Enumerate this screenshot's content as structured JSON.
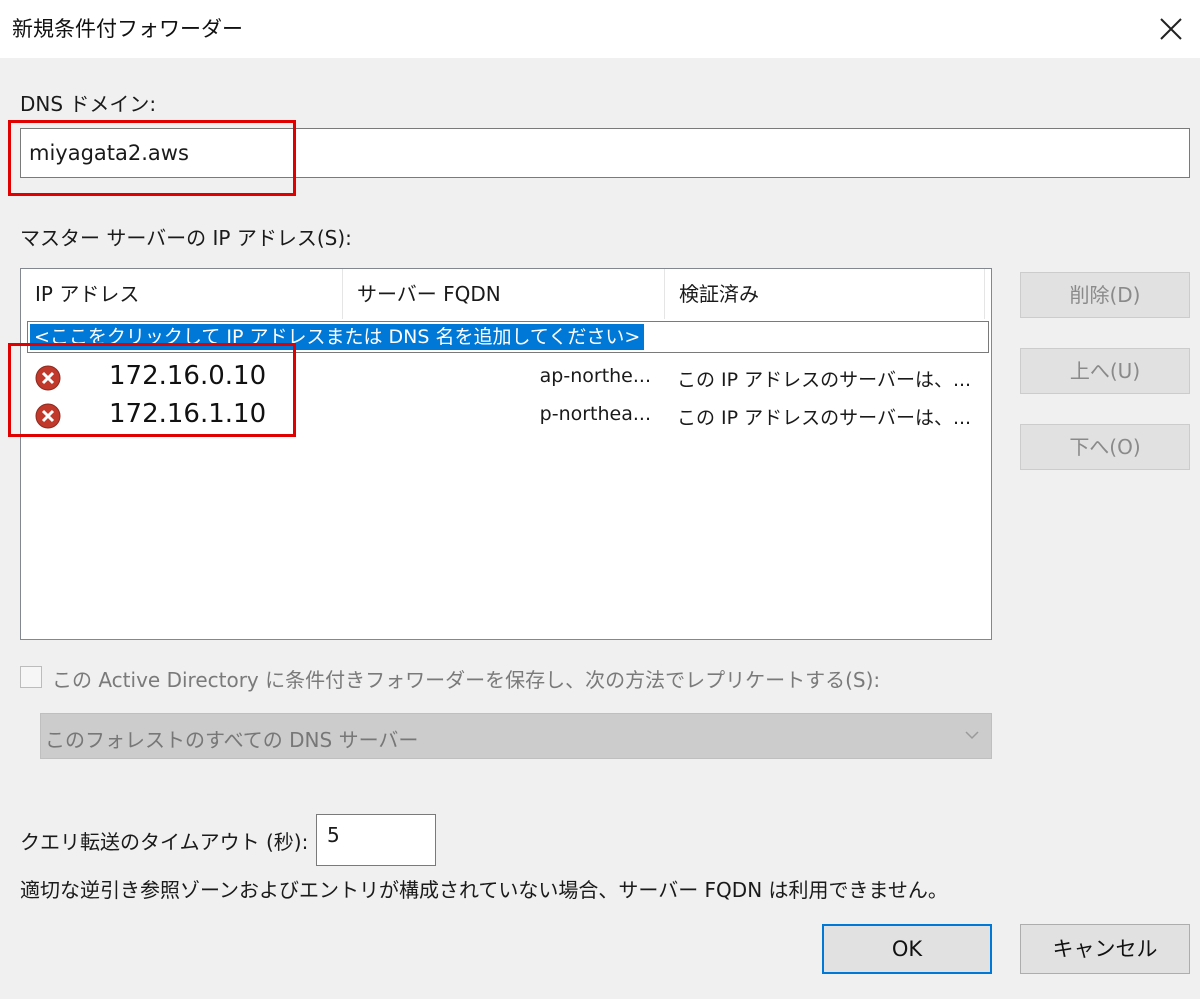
{
  "window": {
    "title": "新規条件付フォワーダー"
  },
  "dns_domain": {
    "label": "DNS ドメイン:",
    "value": "miyagata2.aws"
  },
  "master_servers": {
    "label": "マスター サーバーの IP アドレス(S):",
    "columns": [
      "IP アドレス",
      "サーバー FQDN",
      "検証済み"
    ],
    "add_prompt": "<ここをクリックして IP アドレスまたは DNS 名を追加してください>",
    "rows": [
      {
        "ip": "172.16.0.10",
        "fqdn": "ap-northe...",
        "verified": "この IP アドレスのサーバーは、...",
        "status_icon": "error-icon"
      },
      {
        "ip": "172.16.1.10",
        "fqdn": "p-northea...",
        "verified": "この IP アドレスのサーバーは、...",
        "status_icon": "error-icon"
      }
    ]
  },
  "side_buttons": {
    "delete": "削除(D)",
    "up": "上へ(U)",
    "down": "下へ(O)"
  },
  "replicate": {
    "checkbox_label": "この Active Directory に条件付きフォワーダーを保存し、次の方法でレプリケートする(S):",
    "checked": false,
    "selected_option": "このフォレストのすべての DNS サーバー"
  },
  "timeout": {
    "label": "クエリ転送のタイムアウト (秒):",
    "value": "5"
  },
  "note": "適切な逆引き参照ゾーンおよびエントリが構成されていない場合、サーバー FQDN は利用できません。",
  "buttons": {
    "ok": "OK",
    "cancel": "キャンセル"
  },
  "colors": {
    "selection": "#0078d7",
    "highlight_box": "#e00000",
    "error_icon": "#c0392b"
  }
}
